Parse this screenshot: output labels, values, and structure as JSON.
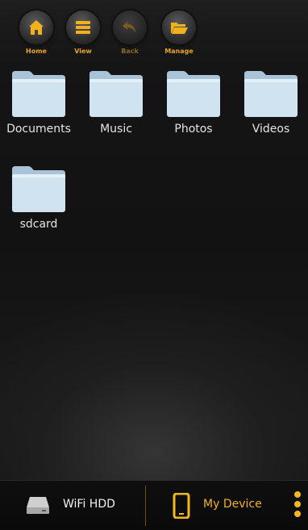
{
  "toolbar": {
    "buttons": [
      {
        "id": "home",
        "label": "Home",
        "icon": "home-icon"
      },
      {
        "id": "view",
        "label": "View",
        "icon": "list-icon"
      },
      {
        "id": "back",
        "label": "Back",
        "icon": "back-arrow-icon"
      },
      {
        "id": "manage",
        "label": "Manage",
        "icon": "folder-open-icon"
      }
    ]
  },
  "folders": [
    {
      "name": "Documents"
    },
    {
      "name": "Music"
    },
    {
      "name": "Photos"
    },
    {
      "name": "Videos"
    },
    {
      "name": "sdcard"
    }
  ],
  "bottom_bar": {
    "wifi_label": "WiFi HDD",
    "device_label": "My Device",
    "wifi_icon": "hard-drive-icon",
    "device_icon": "phone-icon",
    "overflow_icon": "more-vertical-icon"
  },
  "colors": {
    "accent": "#e6a31d",
    "active_tab": "#f0b424",
    "folder": "#cfe3f1",
    "background": "#141414"
  }
}
